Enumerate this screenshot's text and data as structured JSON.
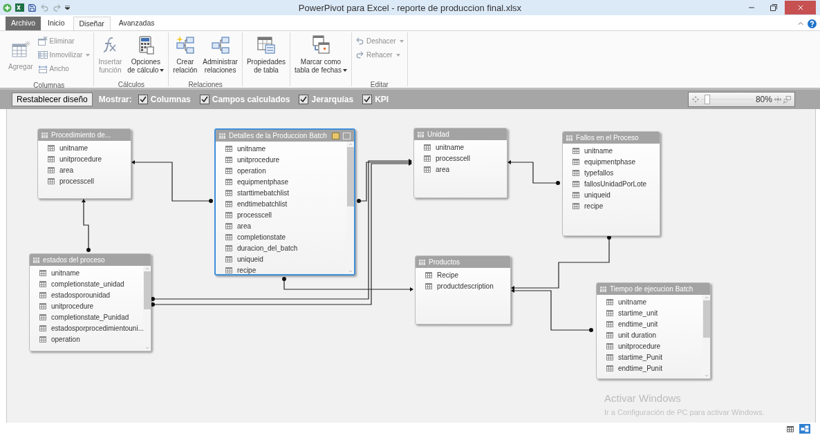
{
  "window": {
    "title": "PowerPivot para Excel - reporte de produccion final.xlsx"
  },
  "ribbon_tabs": [
    {
      "label": "Archivo",
      "kind": "file",
      "selected": false
    },
    {
      "label": "Inicio",
      "kind": "tab",
      "selected": false
    },
    {
      "label": "Diseñar",
      "kind": "tab",
      "selected": true
    },
    {
      "label": "Avanzadas",
      "kind": "tab",
      "selected": false
    }
  ],
  "ribbon_groups": [
    {
      "label": "Columnas",
      "buttons": [
        {
          "kind": "large",
          "lines": [
            "Agregar"
          ],
          "disabled": true,
          "dropdown": false
        },
        {
          "kind": "small",
          "lines": [
            "Eliminar"
          ],
          "disabled": true,
          "dropdown": false
        },
        {
          "kind": "small",
          "lines": [
            "Inmovilizar"
          ],
          "disabled": true,
          "dropdown": true
        },
        {
          "kind": "small",
          "lines": [
            "Ancho"
          ],
          "disabled": true,
          "dropdown": false
        }
      ]
    },
    {
      "label": "Cálculos",
      "buttons": [
        {
          "kind": "large",
          "lines": [
            "Insertar",
            "función"
          ],
          "disabled": true,
          "dropdown": false
        },
        {
          "kind": "large",
          "lines": [
            "Opciones",
            "de cálculo"
          ],
          "disabled": false,
          "dropdown": true
        }
      ]
    },
    {
      "label": "Relaciones",
      "buttons": [
        {
          "kind": "large",
          "lines": [
            "Crear",
            "relación"
          ],
          "disabled": false,
          "dropdown": false
        },
        {
          "kind": "large",
          "lines": [
            "Administrar",
            "relaciones"
          ],
          "disabled": false,
          "dropdown": false
        }
      ]
    },
    {
      "buttons": [
        {
          "kind": "large",
          "lines": [
            "Propiedades",
            "de tabla"
          ],
          "disabled": false,
          "dropdown": false
        }
      ]
    },
    {
      "buttons": [
        {
          "kind": "large",
          "lines": [
            "Marcar como",
            "tabla de fechas"
          ],
          "disabled": false,
          "dropdown": true
        }
      ]
    },
    {
      "label": "Editar",
      "buttons": [
        {
          "kind": "small",
          "lines": [
            "Deshacer"
          ],
          "disabled": true,
          "dropdown": true
        },
        {
          "kind": "small",
          "lines": [
            "Rehacer"
          ],
          "disabled": true,
          "dropdown": true
        }
      ]
    }
  ],
  "toolbar": {
    "reset_button": "Restablecer diseño",
    "show_label": "Mostrar:",
    "show_options": [
      {
        "label": "Columnas",
        "checked": true
      },
      {
        "label": "Campos calculados",
        "checked": true
      },
      {
        "label": "Jerarquías",
        "checked": true
      },
      {
        "label": "KPI",
        "checked": true
      }
    ],
    "zoom": {
      "level": 0.06,
      "reading": "80%"
    }
  },
  "tables": [
    {
      "title": "Procedimiento de...",
      "selected": false,
      "scrollbar": false,
      "fields": [
        "unitname",
        "unitprocedure",
        "area",
        "processcell"
      ]
    },
    {
      "title": "Detalles de la Produccion Batch",
      "selected": true,
      "scrollbar": true,
      "fields": [
        "unitname",
        "unitprocedure",
        "operation",
        "equipmentphase",
        "starttimebatchlist",
        "endtimebatchlist",
        "processcell",
        "area",
        "completionstate",
        "duracion_del_batch",
        "uniqueid",
        "recipe"
      ]
    },
    {
      "title": "Unidad",
      "selected": false,
      "scrollbar": false,
      "fields": [
        "unitname",
        "processcell",
        "area"
      ]
    },
    {
      "title": "Fallos en el Proceso",
      "selected": false,
      "scrollbar": false,
      "fields": [
        "unitname",
        "equipmentphase",
        "typefallos",
        "fallosUnidadPorLote",
        "uniqueid",
        "recipe"
      ]
    },
    {
      "title": "estados del proceso",
      "selected": false,
      "scrollbar": true,
      "fields": [
        "unitname",
        "completionstate_unidad",
        "estadosporounidad",
        "unitprocedure",
        "completionstate_Punidad",
        "estadosporprocedimientouni...",
        "operation"
      ]
    },
    {
      "title": "Productos",
      "selected": false,
      "scrollbar": false,
      "fields": [
        "Recipe",
        "productdescription"
      ]
    },
    {
      "title": "Tiempo de ejecucion Batch",
      "selected": false,
      "scrollbar": true,
      "fields": [
        "unitname",
        "startime_unit",
        "endtime_unit",
        "unit duration",
        "unitprocedure",
        "startime_Punit",
        "endtime_Punit"
      ]
    }
  ],
  "os_notice": {
    "title": "Activar Windows",
    "text": "Ir a Configuración de PC para activar Windows."
  },
  "view_buttons": [
    {
      "selected": false
    },
    {
      "selected": true
    }
  ]
}
